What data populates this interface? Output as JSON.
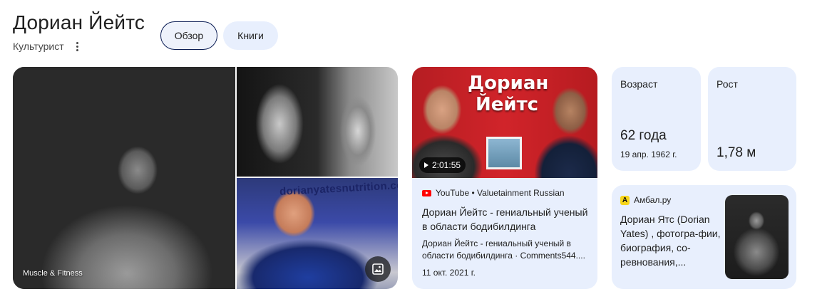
{
  "header": {
    "title": "Дориан Йейтс",
    "subtitle": "Культурист"
  },
  "chips": [
    {
      "label": "Обзор",
      "selected": true
    },
    {
      "label": "Книги",
      "selected": false
    }
  ],
  "images": {
    "main_source": "Muscle & Fitness",
    "watermark_text": "dorianyatesnutrition.com"
  },
  "video": {
    "thumb_title": "Дориан Йейтс",
    "duration": "2:01:55",
    "source": "YouTube • Valuetainment Russian",
    "title": "Дориан Йейтс - гениальный ученый в области бодибилдинга",
    "description": "Дориан Йейтс - гениальный ученый в области бодибилдинга · Comments544....",
    "date": "11 окт. 2021 г."
  },
  "facts": {
    "age": {
      "label": "Возраст",
      "value": "62 года",
      "sub": "19 апр. 1962 г."
    },
    "height": {
      "label": "Рост",
      "value": "1,78 м"
    }
  },
  "article": {
    "site_icon_letter": "А",
    "site": "Амбал.ру",
    "title": "Дориан Ятс (Dorian Yates) , фотогра-фии, биография, со-ревнования,..."
  },
  "colors": {
    "card_bg": "#e8effd",
    "chip_selected_border": "#0b1d54",
    "youtube_red": "#ff0000"
  },
  "icons": [
    "more-vert-icon",
    "image-icon",
    "play-icon",
    "youtube-icon",
    "site-favicon-icon"
  ]
}
